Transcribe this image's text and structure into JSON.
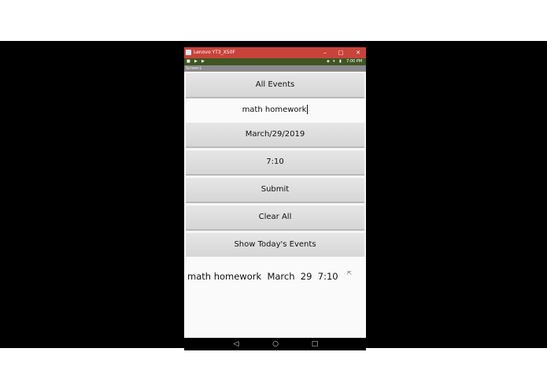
{
  "window": {
    "title": "Lenovo YT3_X50F",
    "minimize_glyph": "‒",
    "maximize_glyph": "□",
    "close_glyph": "✕"
  },
  "status_bar": {
    "time": "7:00 PM",
    "icons": [
      "record-icon",
      "play-icon",
      "play-icon",
      "rotate-icon",
      "wifi-icon",
      "battery-icon"
    ]
  },
  "screen": {
    "title": "Screen1"
  },
  "buttons": {
    "all_events": "All Events",
    "date": "March/29/2019",
    "time": "7:10",
    "submit": "Submit",
    "clear_all": "Clear All",
    "show_today": "Show Today's Events"
  },
  "event_input": {
    "value": "math homework"
  },
  "output": {
    "text": "math homework  March  29  7:10"
  },
  "nav": {
    "back": "◁",
    "home": "○",
    "recents": "□"
  }
}
